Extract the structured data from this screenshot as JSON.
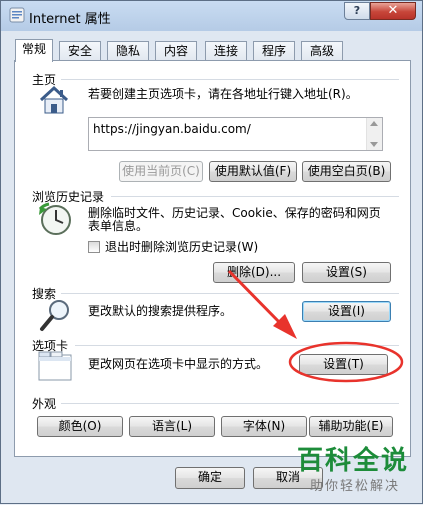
{
  "window": {
    "title": "Internet 属性",
    "help": "?",
    "close": "✕"
  },
  "tabs": [
    {
      "label": "常规",
      "active": true
    },
    {
      "label": "安全"
    },
    {
      "label": "隐私"
    },
    {
      "label": "内容"
    },
    {
      "label": "连接"
    },
    {
      "label": "程序"
    },
    {
      "label": "高级"
    }
  ],
  "home": {
    "title": "主页",
    "desc": "若要创建主页选项卡，请在各地址行键入地址(R)。",
    "url": "https://jingyan.baidu.com/",
    "btn_current": "使用当前页(C)",
    "btn_default": "使用默认值(F)",
    "btn_blank": "使用空白页(B)"
  },
  "history": {
    "title": "浏览历史记录",
    "desc1": "删除临时文件、历史记录、Cookie、保存的密码和网页",
    "desc2": "表单信息。",
    "checkbox": "退出时删除浏览历史记录(W)",
    "btn_delete": "删除(D)...",
    "btn_settings": "设置(S)"
  },
  "search": {
    "title": "搜索",
    "desc": "更改默认的搜索提供程序。",
    "btn_settings": "设置(I)"
  },
  "tabs_group": {
    "title": "选项卡",
    "desc": "更改网页在选项卡中显示的方式。",
    "btn_settings": "设置(T)"
  },
  "appearance": {
    "title": "外观",
    "btn_colors": "颜色(O)",
    "btn_languages": "语言(L)",
    "btn_fonts": "字体(N)",
    "btn_accessibility": "辅助功能(E)"
  },
  "footer": {
    "ok": "确定",
    "cancel": "取消"
  },
  "watermark": {
    "title": "百科全说",
    "subtitle": "助你轻松解决"
  },
  "colors": {
    "annotation": "#e8332c",
    "watermark": "#1d8c3a"
  }
}
